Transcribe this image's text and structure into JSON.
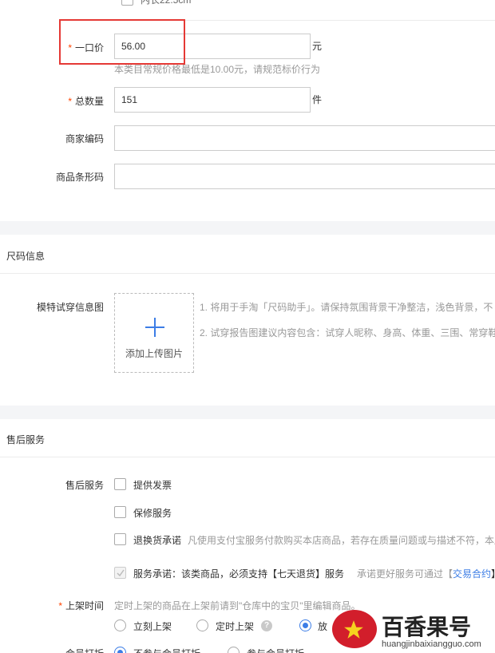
{
  "top_option": {
    "label": "内长22.5cm"
  },
  "price": {
    "label": "一口价",
    "value": "56.00",
    "unit": "元",
    "hint": "本类目常规价格最低是10.00元，请规范标价行为"
  },
  "quantity": {
    "label": "总数量",
    "value": "151",
    "unit": "件"
  },
  "merchant_code": {
    "label": "商家编码",
    "value": ""
  },
  "barcode": {
    "label": "商品条形码",
    "value": ""
  },
  "size_section": {
    "title": "尺码信息",
    "model_label": "模特试穿信息图",
    "upload_label": "添加上传图片",
    "tip1": "1. 将用于手淘「尺码助手」。请保持氛围背景干净整洁，浅色背景，不",
    "tip2": "2. 试穿报告图建议内容包含：试穿人昵称、身高、体重、三围、常穿鞋"
  },
  "after_sales": {
    "title": "售后服务",
    "label": "售后服务",
    "options": [
      "提供发票",
      "保修服务",
      "退换货承诺"
    ],
    "return_desc": "凡使用支付宝服务付款购买本店商品，若存在质量问题或与描述不符，本店",
    "commitment": "服务承诺：该类商品，必须支持【七天退货】服务",
    "better_service": "承诺更好服务可通过【",
    "trade_contract": "交易合约",
    "bracket_close": "】"
  },
  "listing_time": {
    "label": "上架时间",
    "hint": "定时上架的商品在上架前请到\"仓库中的宝贝\"里编辑商品。",
    "options": [
      "立刻上架",
      "定时上架",
      "放"
    ]
  },
  "member_discount": {
    "label": "会员打折",
    "options": [
      "不参与会员打折",
      "参与会员打折"
    ]
  },
  "watermark": {
    "brand": "百香果号",
    "domain": "huangjinbaixiangguo.com",
    "colors": {
      "logo": "#d21e2b",
      "star": "#f6d21f"
    }
  }
}
